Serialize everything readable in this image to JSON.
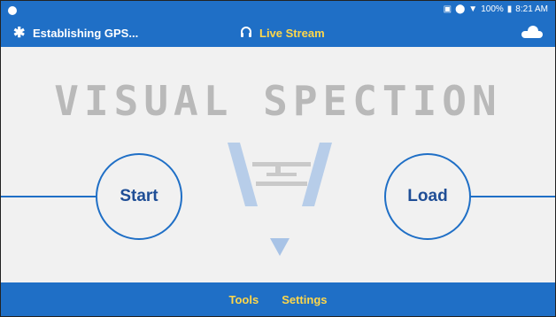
{
  "status_bar": {
    "battery": "100%",
    "time": "8:21 AM"
  },
  "header": {
    "gps_status": "Establishing GPS...",
    "live_stream_label": "Live Stream"
  },
  "logo": {
    "text": "VISUAL SPECTION"
  },
  "actions": {
    "start_label": "Start",
    "load_label": "Load"
  },
  "bottom_nav": {
    "tools_label": "Tools",
    "settings_label": "Settings"
  },
  "colors": {
    "primary": "#1f6fc6",
    "accent": "#ffd74a",
    "background": "#f1f1f1"
  },
  "icons": [
    "bluetooth-searching-icon",
    "headphones-icon",
    "cloud-icon",
    "location-icon",
    "wifi-icon",
    "battery-icon",
    "cast-icon"
  ]
}
